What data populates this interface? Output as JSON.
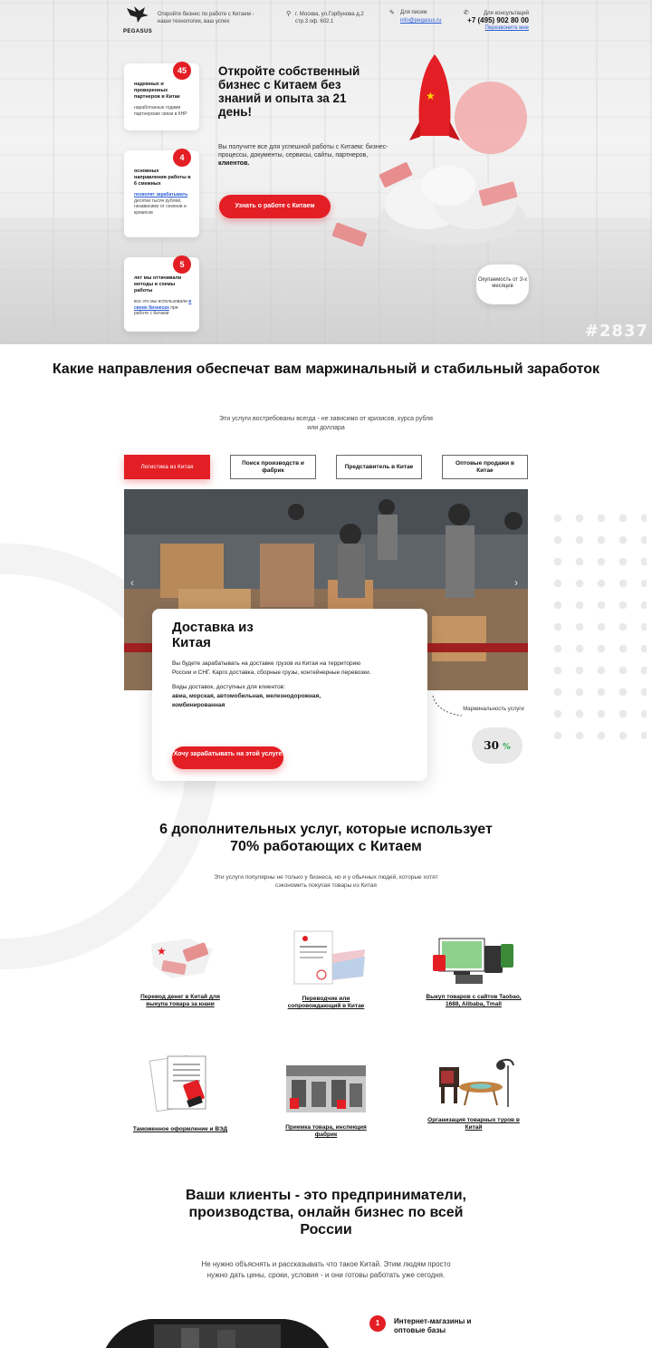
{
  "header": {
    "logo_text": "PEGASUS",
    "tagline": "Откройте бизнес по работе с Китаем - наши технологии, ваш успех",
    "address": "г. Москва, ул.Горбунова д.2 стр.3 оф. 602.1",
    "mail_label": "Для писем",
    "email": "info@pegasus.ru",
    "phone_label": "Для консультаций",
    "phone": "+7 (495) 902 80 00",
    "callback": "Перезвоните мне"
  },
  "stats": [
    {
      "value": "45",
      "title": "надежных и проверенных партнеров в Китае",
      "text": "наработанные годами партнерские связи в КНР"
    },
    {
      "value": "4",
      "title": "основных направления работы в 6 смежных",
      "link": "позволят зарабатывать",
      "text": "десятки тысяч рублей, независимо от сезонов и кризисов"
    },
    {
      "value": "5",
      "title": "лет мы оттачивали методы и схемы работы",
      "text_a": "все это мы использовали ",
      "link": "в своих бизнесах",
      "text_b": " при работе с Китаем"
    }
  ],
  "hero": {
    "title": "Откройте собственный бизнес с Китаем без знаний и опыта за 21 день!",
    "subtitle": "Вы получите все для успешной работы с Китаем: бизнес-процессы, документы, сервисы, сайты, партнеров, ",
    "subtitle_bold": "клиентов.",
    "button": "Узнать о работе с Китаем",
    "payback": "Окупаемость от 3-х месяцев",
    "watermark": "#2837"
  },
  "directions": {
    "title": "Какие направления обеспечат вам маржинальный и стабильный заработок",
    "subtitle": "Эти услуги востребованы всегда - не зависимо от кризисов, курса рубля или доллара",
    "tabs": [
      "Логистика из Китая",
      "Поиск производств и фабрик",
      "Представитель в Китае",
      "Оптовые продажи в Китае"
    ],
    "card_title": "Доставка из Китая",
    "card_desc": "Вы будете зарабатывать на доставке грузов из Китая на территорию России и СНГ. Карго доставка, сборные грузы, контейнерные перевозки.",
    "card_kinds_label": "Виды доставок, доступных для клиентов:",
    "card_kinds": "авиа, морская, автомобильная, железнодорожная, комбинированная",
    "card_button": "Хочу зарабатывать на этой услуге",
    "margin_label": "Маржинальность услуги",
    "margin_value": "30",
    "margin_unit": "%"
  },
  "services": {
    "title": "6 дополнительных услуг, которые использует 70% работающих с Китаем",
    "subtitle": "Эти услуги популярны не только у бизнеса, но и у обычных людей, которые хотят сэкономить покупая товары из Китая",
    "items": [
      "Перевод денег в Китай для выкупа товара за юани",
      "Переводчик или сопровождающий в Китае",
      "Выкуп товаров с сайтов Taobao, 1688, Alibaba, Tmall",
      "Таможенное оформление и ВЭД",
      "Приемка товара, инспекция фабрик",
      "Организация товарных туров в Китай"
    ]
  },
  "clients": {
    "title": "Ваши клиенты - это предприниматели, производства, онлайн бизнес по всей России",
    "subtitle": "Не нужно объяснять и рассказывать что такое Китай. Этим людям просто нужно дать цены, сроки, условия - и они готовы работать уже сегодня.",
    "first_num": "1",
    "first_label": "Интернет-магазины и оптовые базы"
  },
  "colors": {
    "accent": "#e31e24",
    "link": "#2a5bd7",
    "green": "#2aa84a"
  }
}
